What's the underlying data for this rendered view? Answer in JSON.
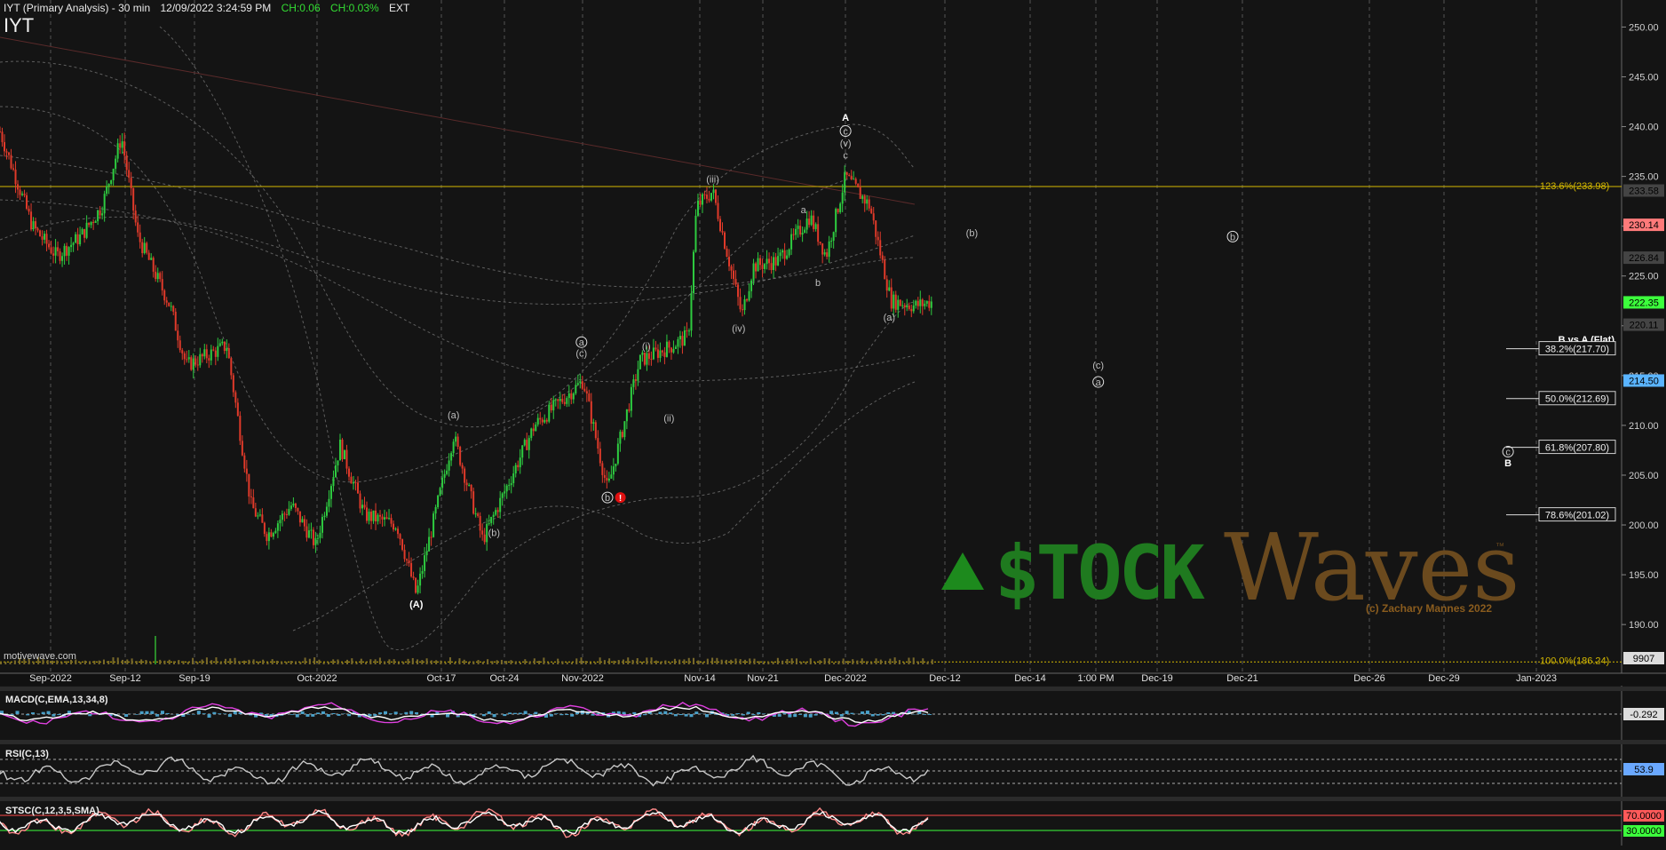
{
  "header": {
    "title": "IYT (Primary Analysis) - 30 min",
    "datetime": "12/09/2022 3:24:59 PM",
    "change_abs": "CH:0.06",
    "change_pct": "CH:0.03%",
    "session": "EXT",
    "symbol": "IYT"
  },
  "watermark": "motivewave.com",
  "logo": {
    "stock_text": "$TOCK",
    "waves_text": "Waves",
    "tm": "™",
    "copyright": "(c) Zachary Mannes 2022"
  },
  "colors": {
    "background": "#141414",
    "up_candle": "#2ecc40",
    "down_candle": "#e03a2a",
    "fib_line": "#d4b800",
    "macd": "#e040e0",
    "accent_green": "#3cff3c"
  },
  "chart_data": [
    {
      "type": "candlestick",
      "title": "IYT (Primary Analysis) - 30 min",
      "ylim": [
        186,
        252
      ],
      "y_ticks": [
        "190.00",
        "195.00",
        "200.00",
        "205.00",
        "210.00",
        "215.00",
        "220.00",
        "225.00",
        "230.00",
        "235.00",
        "240.00",
        "245.00",
        "250.00"
      ],
      "x_ticks": [
        "Sep-2022",
        "Sep-12",
        "Sep-19",
        "Oct-2022",
        "Oct-17",
        "Oct-24",
        "Nov-2022",
        "Nov-14",
        "Nov-21",
        "Dec-2022",
        "Dec-12",
        "Dec-14",
        "1:00 PM",
        "Dec-19",
        "Dec-21",
        "Dec-26",
        "Dec-29",
        "Jan-2023"
      ],
      "price_path": [
        {
          "x": 0.0,
          "y": 239.5
        },
        {
          "x": 0.02,
          "y": 230.0
        },
        {
          "x": 0.035,
          "y": 227.0
        },
        {
          "x": 0.05,
          "y": 229.0
        },
        {
          "x": 0.063,
          "y": 232.0
        },
        {
          "x": 0.075,
          "y": 239.0
        },
        {
          "x": 0.085,
          "y": 229.0
        },
        {
          "x": 0.105,
          "y": 222.0
        },
        {
          "x": 0.115,
          "y": 216.0
        },
        {
          "x": 0.14,
          "y": 218.0
        },
        {
          "x": 0.155,
          "y": 202.0
        },
        {
          "x": 0.165,
          "y": 199.0
        },
        {
          "x": 0.18,
          "y": 202.0
        },
        {
          "x": 0.195,
          "y": 198.0
        },
        {
          "x": 0.21,
          "y": 208.0
        },
        {
          "x": 0.225,
          "y": 201.0
        },
        {
          "x": 0.245,
          "y": 200.0
        },
        {
          "x": 0.257,
          "y": 193.0
        },
        {
          "x": 0.28,
          "y": 209.0
        },
        {
          "x": 0.298,
          "y": 198.5
        },
        {
          "x": 0.33,
          "y": 210.0
        },
        {
          "x": 0.36,
          "y": 214.5
        },
        {
          "x": 0.375,
          "y": 203.5
        },
        {
          "x": 0.395,
          "y": 216.5
        },
        {
          "x": 0.415,
          "y": 218.0
        },
        {
          "x": 0.425,
          "y": 219.0
        },
        {
          "x": 0.43,
          "y": 232.0
        },
        {
          "x": 0.44,
          "y": 233.5
        },
        {
          "x": 0.458,
          "y": 221.0
        },
        {
          "x": 0.465,
          "y": 226.0
        },
        {
          "x": 0.48,
          "y": 226.5
        },
        {
          "x": 0.5,
          "y": 231.0
        },
        {
          "x": 0.51,
          "y": 227.0
        },
        {
          "x": 0.522,
          "y": 235.0
        },
        {
          "x": 0.537,
          "y": 232.0
        },
        {
          "x": 0.55,
          "y": 222.5
        },
        {
          "x": 0.565,
          "y": 222.0
        },
        {
          "x": 0.575,
          "y": 222.4
        }
      ],
      "fib_line": {
        "label": "123.6%(233.98)",
        "value": 233.98
      },
      "fib_line_bottom": {
        "label": "100.0%(186.24)",
        "value": 186.24
      },
      "fib_levels_title": "B vs A (Flat)",
      "fib_levels": [
        {
          "label": "38.2%(217.70)",
          "value": 217.7
        },
        {
          "label": "50.0%(212.69)",
          "value": 212.69
        },
        {
          "label": "61.8%(207.80)",
          "value": 207.8
        },
        {
          "label": "78.6%(201.02)",
          "value": 201.02
        }
      ],
      "price_tags": [
        {
          "label": "233.58",
          "value": 233.58,
          "color": "#444444"
        },
        {
          "label": "230.14",
          "value": 230.14,
          "color": "#ff7a7a"
        },
        {
          "label": "226.84",
          "value": 226.84,
          "color": "#444444"
        },
        {
          "label": "222.35",
          "value": 222.35,
          "color": "#3cff3c"
        },
        {
          "label": "220.11",
          "value": 220.11,
          "color": "#444444"
        },
        {
          "label": "214.50",
          "value": 214.5,
          "color": "#5ab4ff"
        }
      ],
      "volume_tag": "9907",
      "wave_labels": [
        {
          "text": "A",
          "x": 0.522,
          "y": 240.6,
          "circled": false,
          "bold": true
        },
        {
          "text": "c",
          "x": 0.522,
          "y": 239.2,
          "circled": true
        },
        {
          "text": "(v)",
          "x": 0.522,
          "y": 238.0,
          "circled": false
        },
        {
          "text": "c",
          "x": 0.522,
          "y": 236.8,
          "circled": false
        },
        {
          "text": "(iii)",
          "x": 0.44,
          "y": 234.4,
          "circled": false
        },
        {
          "text": "a",
          "x": 0.496,
          "y": 231.3,
          "circled": false
        },
        {
          "text": "b",
          "x": 0.505,
          "y": 224.0,
          "circled": false
        },
        {
          "text": "(iv)",
          "x": 0.456,
          "y": 219.4,
          "circled": false
        },
        {
          "text": "(a)",
          "x": 0.549,
          "y": 220.5,
          "circled": false
        },
        {
          "text": "(b)",
          "x": 0.6,
          "y": 229.0,
          "circled": false
        },
        {
          "text": "b",
          "x": 0.761,
          "y": 228.6,
          "circled": true
        },
        {
          "text": "(c)",
          "x": 0.678,
          "y": 215.7,
          "circled": false
        },
        {
          "text": "a",
          "x": 0.678,
          "y": 214.0,
          "circled": true
        },
        {
          "text": "c",
          "x": 0.931,
          "y": 207.0,
          "circled": true
        },
        {
          "text": "B",
          "x": 0.931,
          "y": 205.9,
          "circled": false,
          "bold": true
        },
        {
          "text": "a",
          "x": 0.359,
          "y": 218.0,
          "circled": true
        },
        {
          "text": "(c)",
          "x": 0.359,
          "y": 216.9,
          "circled": false
        },
        {
          "text": "(i)",
          "x": 0.399,
          "y": 217.6,
          "circled": false
        },
        {
          "text": "(ii)",
          "x": 0.413,
          "y": 210.4,
          "circled": false
        },
        {
          "text": "b",
          "x": 0.375,
          "y": 202.4,
          "circled": true
        },
        {
          "text": "(a)",
          "x": 0.28,
          "y": 210.7,
          "circled": false
        },
        {
          "text": "(b)",
          "x": 0.305,
          "y": 198.9,
          "circled": false
        },
        {
          "text": "(A)",
          "x": 0.257,
          "y": 191.7,
          "circled": false,
          "bold": true
        }
      ]
    },
    {
      "type": "line",
      "title": "MACD(C,EMA,13,34,8)",
      "value_tag": "-0.292"
    },
    {
      "type": "line",
      "title": "RSI(C,13)",
      "value_tag": "53.9"
    },
    {
      "type": "line",
      "title": "STSC(C,12,3,5,SMA)",
      "value_tags": [
        "70.0000",
        "30.0000"
      ]
    }
  ]
}
